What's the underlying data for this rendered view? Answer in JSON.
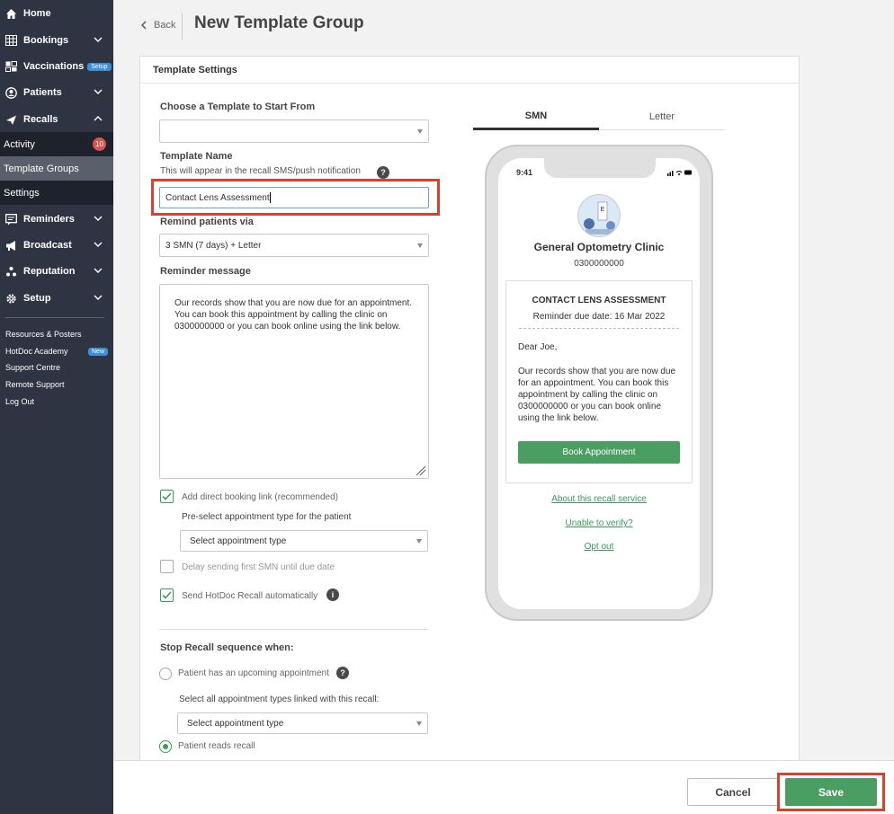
{
  "sidebar": {
    "items": [
      {
        "label": "Home",
        "icon": "home-icon"
      },
      {
        "label": "Bookings",
        "icon": "grid-icon"
      },
      {
        "label": "Vaccinations",
        "icon": "vaccine-icon",
        "tag": "Setup"
      },
      {
        "label": "Patients",
        "icon": "patient-icon"
      },
      {
        "label": "Recalls",
        "icon": "send-icon"
      },
      {
        "label": "Reminders",
        "icon": "reminder-icon"
      },
      {
        "label": "Broadcast",
        "icon": "megaphone-icon"
      },
      {
        "label": "Reputation",
        "icon": "reputation-icon"
      },
      {
        "label": "Setup",
        "icon": "gear-icon"
      }
    ],
    "recalls_sub": [
      {
        "label": "Activity",
        "badge": "10"
      },
      {
        "label": "Template Groups"
      },
      {
        "label": "Settings"
      }
    ],
    "links": [
      {
        "label": "Resources & Posters"
      },
      {
        "label": "HotDoc Academy",
        "tag": "New"
      },
      {
        "label": "Support Centre"
      },
      {
        "label": "Remote Support"
      },
      {
        "label": "Log Out"
      }
    ]
  },
  "header": {
    "back_label": "Back",
    "title": "New Template Group"
  },
  "form": {
    "section_title": "Template Settings",
    "choose_template_label": "Choose a Template to Start From",
    "choose_template_value": "",
    "template_name_label": "Template Name",
    "template_name_help": "This will appear in the recall SMS/push notification",
    "template_name_value": "Contact Lens Assessment",
    "remind_via_label": "Remind patients via",
    "remind_via_value": "3 SMN (7 days) + Letter",
    "reminder_message_label": "Reminder message",
    "reminder_message_value": "Our records show that you are now due for an appointment. You can book this appointment by calling the clinic on 0300000000 or you can book online using the link below.",
    "add_booking_link_label": "Add direct booking link (recommended)",
    "add_booking_link_checked": true,
    "preselect_label": "Pre-select appointment type for the patient",
    "preselect_placeholder": "Select appointment type",
    "delay_label": "Delay sending first SMN until due date",
    "delay_checked": false,
    "send_auto_label": "Send HotDoc Recall automatically",
    "send_auto_checked": true,
    "stop_label": "Stop Recall sequence when:",
    "stop_option1": "Patient has an upcoming appointment",
    "select_types_label": "Select all appointment types linked with this recall:",
    "select_types_placeholder": "Select appointment type",
    "stop_option2": "Patient reads recall",
    "stop_selected": "Patient reads recall"
  },
  "preview": {
    "tabs": [
      {
        "label": "SMN",
        "active": true
      },
      {
        "label": "Letter",
        "active": false
      }
    ],
    "time": "9:41",
    "clinic_name": "General Optometry Clinic",
    "clinic_phone": "0300000000",
    "msg_title": "CONTACT LENS ASSESSMENT",
    "msg_date": "Reminder due date: 16 Mar 2022",
    "msg_greeting": "Dear Joe,",
    "msg_body": "Our records show that you are now due for an appointment. You can book this appointment by calling the clinic on 0300000000 or you can book online using the link below.",
    "book_label": "Book Appointment",
    "link_about": "About this recall service",
    "link_unable": "Unable to verify?",
    "link_opt": "Opt out"
  },
  "footer": {
    "cancel_label": "Cancel",
    "save_label": "Save"
  },
  "colors": {
    "sidebar_bg": "#2f3443",
    "accent_green": "#4a9e62",
    "highlight_red": "#d7412e",
    "badge_red": "#d9534f"
  }
}
